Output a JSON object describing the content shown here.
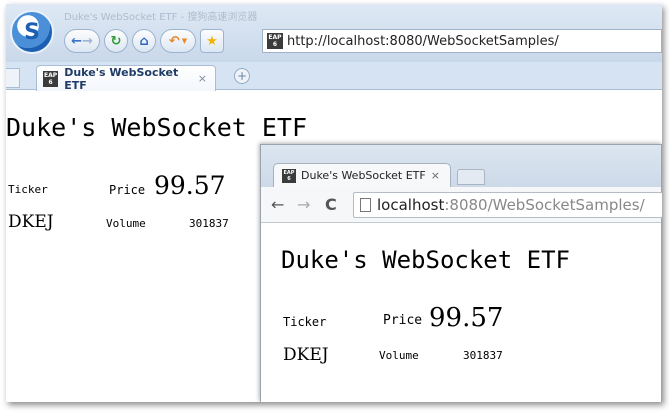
{
  "browser_a": {
    "window_title": "Duke's WebSocket ETF - 搜狗高速浏览器",
    "nav": {
      "back_icon": "back-arrow",
      "forward_icon": "forward-arrow",
      "refresh_icon": "refresh",
      "home_icon": "home",
      "undo_icon": "undo",
      "favorite_icon": "star"
    },
    "address": "http://localhost:8080/WebSocketSamples/",
    "tab": {
      "label": "Duke's WebSocket ETF",
      "close": "×"
    },
    "newtab_label": "+",
    "favicon": {
      "line1": "EAP",
      "line2": "6"
    },
    "page": {
      "heading": "Duke's WebSocket ETF",
      "ticker_label": "Ticker",
      "price_label": "Price",
      "price_value": "99.57",
      "symbol": "DKEJ",
      "volume_label": "Volume",
      "volume_value": "301837"
    }
  },
  "browser_b": {
    "tab": {
      "label": "Duke's WebSocket ETF",
      "close": "×"
    },
    "favicon": {
      "line1": "EAP",
      "line2": "6"
    },
    "nav": {
      "back": "←",
      "forward": "→",
      "reload": "C"
    },
    "address_host": "localhost",
    "address_rest": ":8080/WebSocketSamples/",
    "page": {
      "heading": "Duke's WebSocket ETF",
      "ticker_label": "Ticker",
      "price_label": "Price",
      "price_value": "99.57",
      "symbol": "DKEJ",
      "volume_label": "Volume",
      "volume_value": "301837"
    }
  },
  "colors": {
    "chrome_blue": "#c9d8ea",
    "tab_text": "#1f3b66",
    "text": "#000000"
  }
}
